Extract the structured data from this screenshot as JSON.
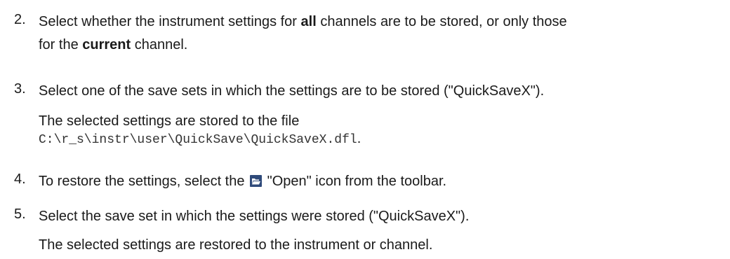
{
  "steps": [
    {
      "number": "2.",
      "line1_pre": "Select whether the instrument settings for ",
      "line1_bold": "all",
      "line1_post": " channels are to be stored, or only those",
      "line2_pre": "for the ",
      "line2_bold": "current",
      "line2_post": " channel."
    },
    {
      "number": "3.",
      "text": "Select one of the save sets in which the settings are to be stored (\"QuickSaveX\").",
      "result_text": "The selected settings are stored to the file",
      "result_path": "C:\\r_s\\instr\\user\\QuickSave\\QuickSaveX.dfl",
      "result_period": "."
    },
    {
      "number": "4.",
      "text_pre": "To restore the settings, select the ",
      "icon": "folder-open-icon",
      "text_post": " \"Open\" icon from the toolbar."
    },
    {
      "number": "5.",
      "text": "Select the save set in which the settings were stored (\"QuickSaveX\").",
      "result_text": "The selected settings are restored to the instrument or channel."
    }
  ],
  "colors": {
    "text": "#1a1a1a",
    "icon_background": "#2f4a7a",
    "icon_glyph": "#ffffff"
  }
}
